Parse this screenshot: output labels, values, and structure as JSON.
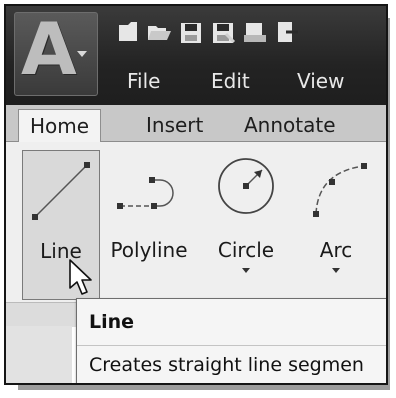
{
  "menu": {
    "file": "File",
    "edit": "Edit",
    "view": "View"
  },
  "tabs": {
    "home": "Home",
    "insert": "Insert",
    "annotate": "Annotate"
  },
  "tools": {
    "line": "Line",
    "polyline": "Polyline",
    "circle": "Circle",
    "arc": "Arc"
  },
  "tooltip": {
    "title": "Line",
    "description": "Creates straight line segmen"
  }
}
